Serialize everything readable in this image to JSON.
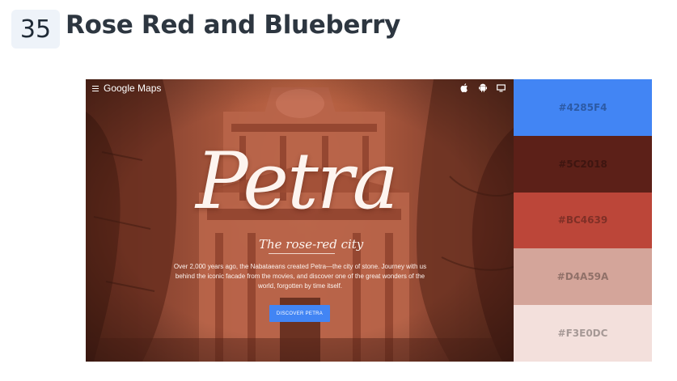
{
  "header": {
    "number": "35",
    "title": "Rose Red and Blueberry"
  },
  "hero": {
    "brand": "Google Maps",
    "icons": [
      "menu-icon",
      "apple-icon",
      "android-icon",
      "desktop-icon"
    ],
    "title": "Petra",
    "subtitle": "The rose-red city",
    "blurb": "Over 2,000 years ago, the Nabataeans created Petra—the city of stone. Journey with us behind the iconic facade from the movies, and discover one of the great wonders of the world, forgotten by time itself.",
    "cta": "DISCOVER PETRA"
  },
  "palette": {
    "swatches": [
      {
        "hex": "#4285F4",
        "label": "#4285F4"
      },
      {
        "hex": "#5C2018",
        "label": "#5C2018"
      },
      {
        "hex": "#BC4639",
        "label": "#BC4639"
      },
      {
        "hex": "#D4A59A",
        "label": "#D4A59A"
      },
      {
        "hex": "#F3E0DC",
        "label": "#F3E0DC"
      }
    ]
  }
}
